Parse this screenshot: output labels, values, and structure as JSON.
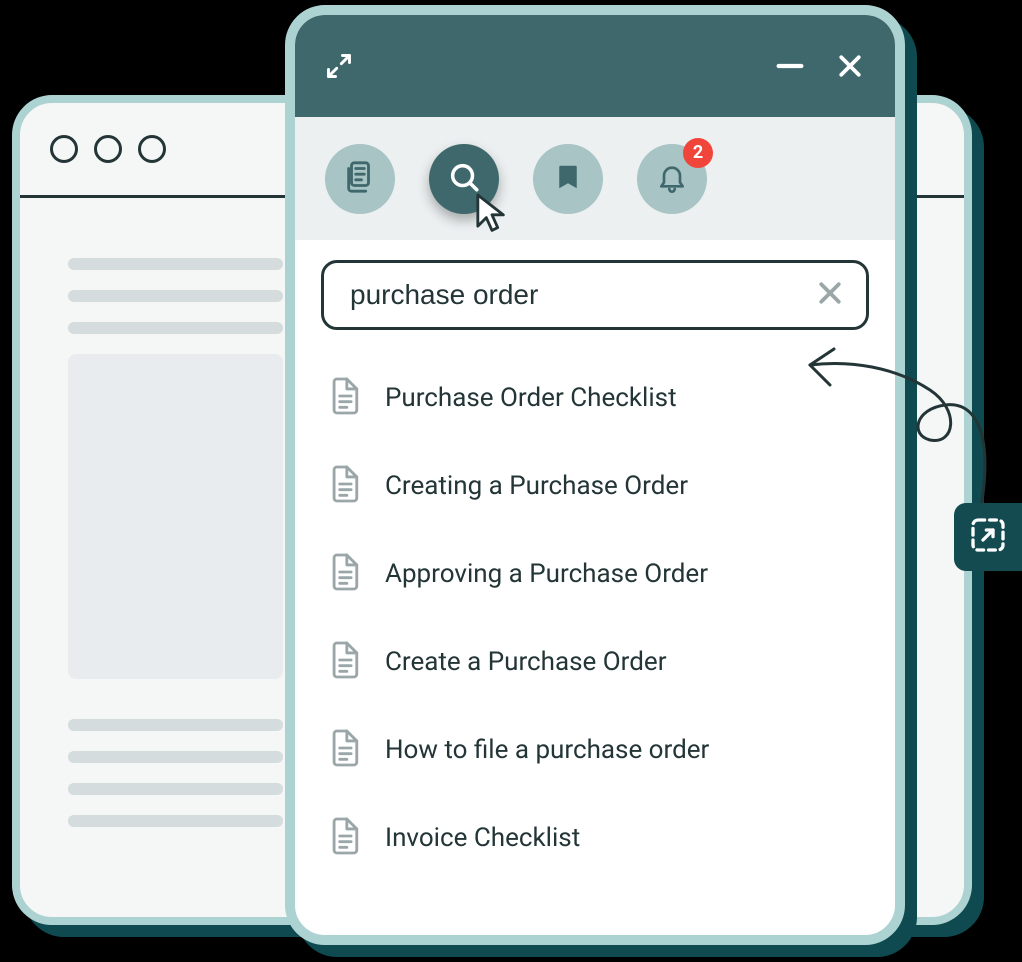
{
  "search": {
    "value": "purchase order"
  },
  "notifications": {
    "count": "2"
  },
  "results": [
    {
      "label": "Purchase Order Checklist"
    },
    {
      "label": "Creating a Purchase Order"
    },
    {
      "label": "Approving a Purchase Order"
    },
    {
      "label": "Create a Purchase Order"
    },
    {
      "label": "How to file a purchase order"
    },
    {
      "label": "Invoice Checklist"
    }
  ]
}
